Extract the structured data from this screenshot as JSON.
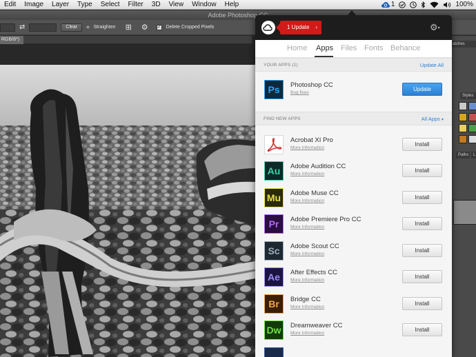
{
  "menubar": {
    "items": [
      "Edit",
      "Image",
      "Layer",
      "Type",
      "Select",
      "Filter",
      "3D",
      "View",
      "Window",
      "Help"
    ],
    "status": {
      "cc_count": "1",
      "battery": "100%"
    }
  },
  "ps_window": {
    "title": "Adobe Photoshop CC"
  },
  "options_bar": {
    "clear_label": "Clear",
    "straighten_label": "Straighten",
    "delete_cropped_label": "Delete Cropped Pixels"
  },
  "document_tab": {
    "label": "RGB/8*)"
  },
  "right_panel": {
    "swatches_tab": "atches",
    "styles_tab": "Styles",
    "paths_tab": "Paths",
    "layers_tab": "L"
  },
  "cc_panel": {
    "update_badge": "1 Update",
    "nav": [
      "Home",
      "Apps",
      "Files",
      "Fonts",
      "Behance"
    ],
    "active_nav": "Apps",
    "your_apps": {
      "header": "YOUR APPS (1)",
      "action": "Update All",
      "items": [
        {
          "abbr": "Ps",
          "name": "Photoshop CC",
          "sub": "Bug fixes",
          "button": "Update",
          "color": "#2fa3f7",
          "bg": "#0c2a3e"
        }
      ]
    },
    "find_apps": {
      "header": "FIND NEW APPS",
      "action": "All Apps",
      "items": [
        {
          "abbr": "",
          "name": "Acrobat XI Pro",
          "sub": "More Information",
          "button": "Install",
          "color": "#d32f2f",
          "bg": "#ffffff"
        },
        {
          "abbr": "Au",
          "name": "Adobe Audition CC",
          "sub": "More Information",
          "button": "Install",
          "color": "#3cd3a7",
          "bg": "#0a2b27"
        },
        {
          "abbr": "Mu",
          "name": "Adobe Muse CC",
          "sub": "More Information",
          "button": "Install",
          "color": "#e6e043",
          "bg": "#2a2a0a"
        },
        {
          "abbr": "Pr",
          "name": "Adobe Premiere Pro CC",
          "sub": "More Information",
          "button": "Install",
          "color": "#b06bf0",
          "bg": "#2a0e3e"
        },
        {
          "abbr": "Sc",
          "name": "Adobe Scout CC",
          "sub": "More Information",
          "button": "Install",
          "color": "#9fb0bf",
          "bg": "#1e2831"
        },
        {
          "abbr": "Ae",
          "name": "After Effects CC",
          "sub": "More Information",
          "button": "Install",
          "color": "#9d8cf5",
          "bg": "#1c1540"
        },
        {
          "abbr": "Br",
          "name": "Bridge CC",
          "sub": "More Information",
          "button": "Install",
          "color": "#f0a34a",
          "bg": "#3a1f05"
        },
        {
          "abbr": "Dw",
          "name": "Dreamweaver CC",
          "sub": "More Information",
          "button": "Install",
          "color": "#6de23d",
          "bg": "#123a0a"
        }
      ]
    }
  }
}
